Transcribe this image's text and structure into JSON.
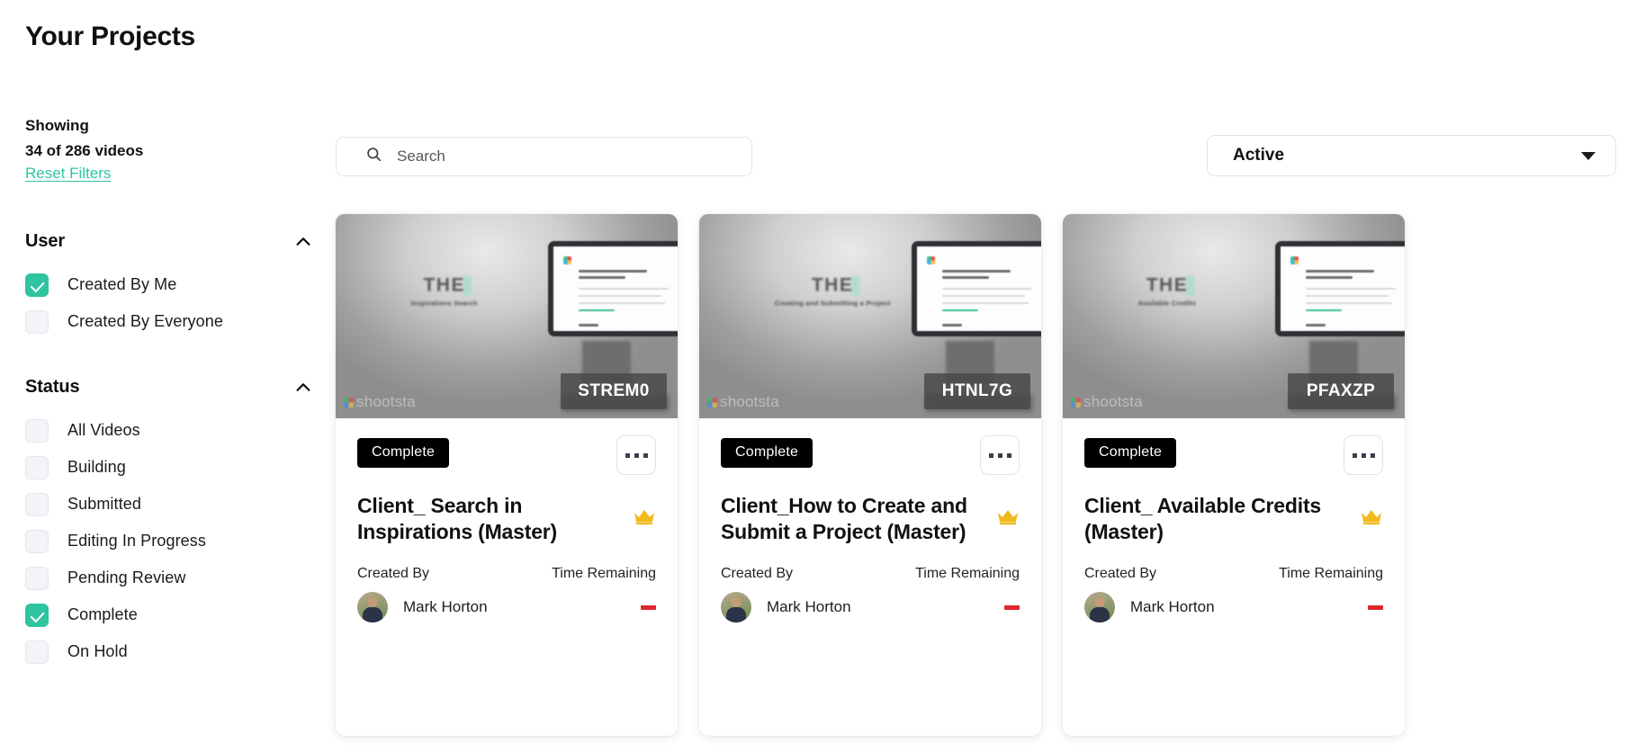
{
  "header": {
    "title": "Your Projects"
  },
  "sidebar": {
    "showing_label": "Showing",
    "showing_count": "34 of 286 videos",
    "reset_filters": "Reset Filters",
    "groups": [
      {
        "title": "User",
        "collapse_icon": "chevron-up-icon",
        "items": [
          {
            "label": "Created By Me",
            "checked": true
          },
          {
            "label": "Created By Everyone",
            "checked": false
          }
        ]
      },
      {
        "title": "Status",
        "collapse_icon": "chevron-up-icon",
        "items": [
          {
            "label": "All Videos",
            "checked": false
          },
          {
            "label": "Building",
            "checked": false
          },
          {
            "label": "Submitted",
            "checked": false
          },
          {
            "label": "Editing In Progress",
            "checked": false
          },
          {
            "label": "Pending Review",
            "checked": false
          },
          {
            "label": "Complete",
            "checked": true
          },
          {
            "label": "On Hold",
            "checked": false
          }
        ]
      }
    ]
  },
  "toolbar": {
    "search": {
      "icon": "search-icon",
      "value": "",
      "placeholder": "Search"
    },
    "status_filter": {
      "value": "Active",
      "icon": "chevron-down-icon"
    }
  },
  "cards": [
    {
      "thumb_title": "THE",
      "thumb_subtitle": "Inspirations Search",
      "watermark": "shootsta",
      "code": "STREM0",
      "status": "Complete",
      "more_icon": "ellipsis-icon",
      "title": "Client_ Search in Inspirations (Master)",
      "master_icon": "crown-icon",
      "created_by_label": "Created By",
      "time_remaining_label": "Time Remaining",
      "creator": "Mark Horton",
      "time_remaining": "—"
    },
    {
      "thumb_title": "THE",
      "thumb_subtitle": "Creating and Submitting a Project",
      "watermark": "shootsta",
      "code": "HTNL7G",
      "status": "Complete",
      "more_icon": "ellipsis-icon",
      "title": "Client_How to Create and Submit a Project (Master)",
      "master_icon": "crown-icon",
      "created_by_label": "Created By",
      "time_remaining_label": "Time Remaining",
      "creator": "Mark Horton",
      "time_remaining": "—"
    },
    {
      "thumb_title": "THE",
      "thumb_subtitle": "Available Credits",
      "watermark": "shootsta",
      "code": "PFAXZP",
      "status": "Complete",
      "more_icon": "ellipsis-icon",
      "title": "Client_ Available Credits (Master)",
      "master_icon": "crown-icon",
      "created_by_label": "Created By",
      "time_remaining_label": "Time Remaining",
      "creator": "Mark Horton",
      "time_remaining": "—"
    }
  ],
  "colors": {
    "accent_green": "#2ec4a0",
    "badge_black": "#000000",
    "crown_gold": "#f2b91c",
    "time_red": "#e0252e"
  }
}
